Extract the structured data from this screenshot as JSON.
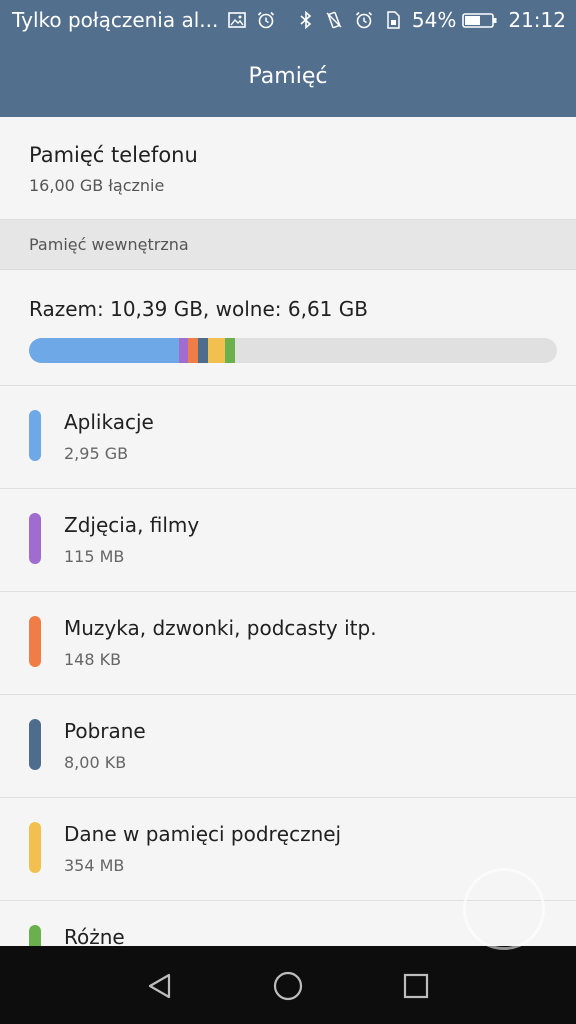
{
  "status_bar": {
    "carrier_text": "Tylko połączenia al...",
    "battery_percent": "54%",
    "time": "21:12",
    "left_icons": [
      "image-icon",
      "alarm-icon"
    ],
    "right_icons": [
      "bluetooth-icon",
      "vibrate-icon",
      "alarm-icon",
      "sim-icon",
      "battery-icon"
    ]
  },
  "header": {
    "title": "Pamięć"
  },
  "phone_memory": {
    "title": "Pamięć telefonu",
    "subtitle": "16,00  GB łącznie"
  },
  "internal_section": {
    "label": "Pamięć wewnętrzna",
    "summary": "Razem: 10,39 GB, wolne: 6,61 GB",
    "bar_track_color": "#e0e0e0"
  },
  "categories": [
    {
      "name": "Aplikacje",
      "size": "2,95 GB",
      "color": "#6fa8e6"
    },
    {
      "name": "Zdjęcia, filmy",
      "size": "115 MB",
      "color": "#a06ccf"
    },
    {
      "name": "Muzyka, dzwonki, podcasty itp.",
      "size": "148 KB",
      "color": "#ef7d45"
    },
    {
      "name": "Pobrane",
      "size": "8,00 KB",
      "color": "#4e6d8c"
    },
    {
      "name": "Dane w pamięci podręcznej",
      "size": "354 MB",
      "color": "#f2c04f"
    },
    {
      "name": "Różne",
      "size": "",
      "color": "#6ab04c"
    }
  ],
  "nav_bar": {
    "buttons": [
      "back-icon",
      "home-icon",
      "recent-apps-icon"
    ]
  },
  "colors": {
    "header_bg": "#536f8e",
    "nav_bg": "#0d0d0d",
    "page_bg": "#f5f5f5"
  }
}
